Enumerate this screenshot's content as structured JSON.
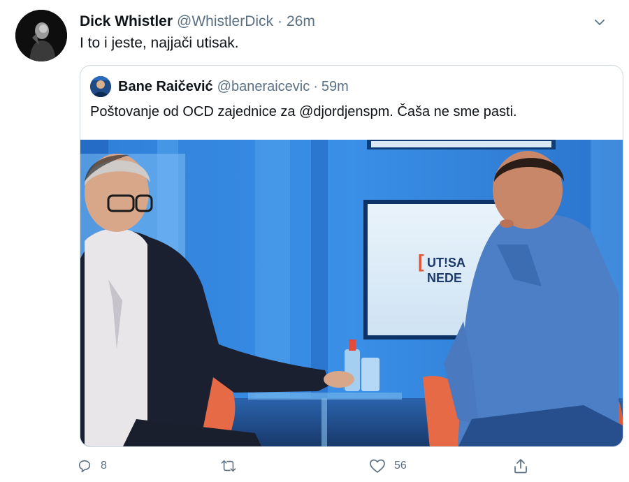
{
  "tweet": {
    "author_name": "Dick Whistler",
    "author_handle": "@WhistlerDick",
    "separator": "·",
    "time": "26m",
    "text": "I to i jeste, najjači utisak."
  },
  "quoted_tweet": {
    "author_name": "Bane Raičević",
    "author_handle": "@baneraicevic",
    "separator": "·",
    "time": "59m",
    "text": "Poštovanje od OCD zajednice za @djordjenspm. Čaša ne sme pasti.",
    "media": {
      "screen_text_line1": "UT!SA",
      "screen_text_line2": "NEDE"
    }
  },
  "actions": {
    "reply_count": "8",
    "retweet_count": "",
    "like_count": "56"
  },
  "icons": {
    "more": "chevron-down-icon",
    "reply": "reply-icon",
    "retweet": "retweet-icon",
    "like": "heart-icon",
    "share": "share-icon"
  },
  "colors": {
    "text_primary": "#0f1419",
    "text_secondary": "#5b7083",
    "border": "#cfd9de"
  }
}
